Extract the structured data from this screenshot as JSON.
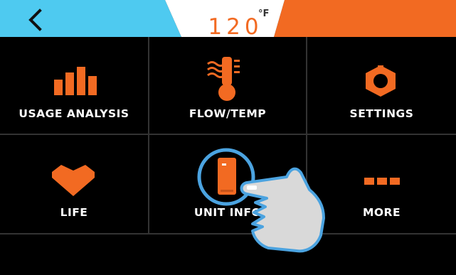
{
  "header": {
    "back_icon": "chevron-left-icon",
    "temperature": "120",
    "unit": "°F",
    "colors": {
      "left": "#4ecaf0",
      "right": "#f26a22",
      "badge": "#ffffff",
      "temp_text": "#f26a22"
    }
  },
  "menu": {
    "items": [
      {
        "label": "USAGE ANALYSIS",
        "icon": "bar-chart-icon"
      },
      {
        "label": "FLOW/TEMP",
        "icon": "thermometer-icon"
      },
      {
        "label": "SETTINGS",
        "icon": "gear-icon"
      },
      {
        "label": "LIFE",
        "icon": "heart-icon"
      },
      {
        "label": "UNIT INFO",
        "icon": "water-heater-unit-icon"
      },
      {
        "label": "MORE",
        "icon": "more-icon"
      }
    ],
    "accent": "#f26a22",
    "highlight": "#4ba3e0"
  },
  "overlay": {
    "icon": "pointing-hand-icon"
  }
}
